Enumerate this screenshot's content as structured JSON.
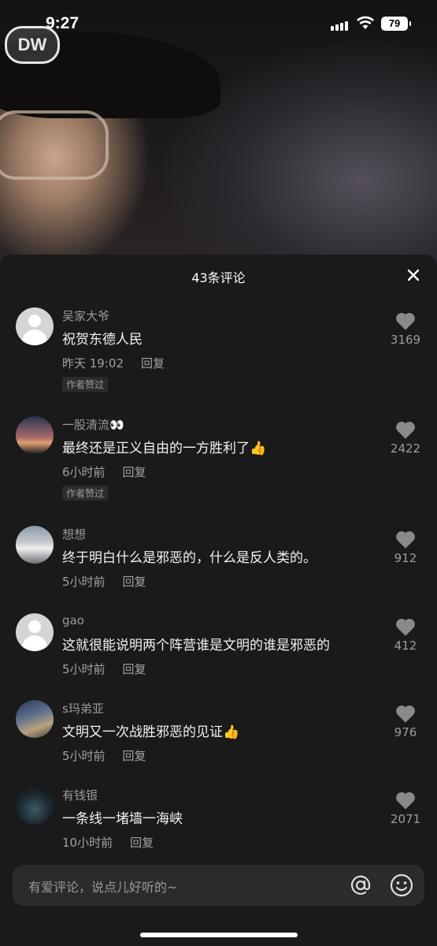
{
  "status": {
    "time": "9:27",
    "battery": "79"
  },
  "video": {
    "logo_text": "DW"
  },
  "sheet": {
    "title": "43条评论"
  },
  "comments": [
    {
      "username": "吴家大爷",
      "text": "祝贺东德人民",
      "time": "昨天 19:02",
      "reply": "回复",
      "badge": "作者赞过",
      "likes": "3169",
      "avatar": "default"
    },
    {
      "username": "一股清流👀",
      "text": "最终还是正义自由的一方胜利了👍",
      "time": "6小时前",
      "reply": "回复",
      "badge": "作者赞过",
      "likes": "2422",
      "avatar": "sunset"
    },
    {
      "username": "想想",
      "text": "终于明白什么是邪恶的，什么是反人类的。",
      "time": "5小时前",
      "reply": "回复",
      "likes": "912",
      "avatar": "car"
    },
    {
      "username": "gao",
      "text": "这就很能说明两个阵营谁是文明的谁是邪恶的",
      "time": "5小时前",
      "reply": "回复",
      "likes": "412",
      "avatar": "default"
    },
    {
      "username": "s玛弟亚",
      "text": "文明又一次战胜邪恶的见证👍",
      "time": "5小时前",
      "reply": "回复",
      "likes": "976",
      "avatar": "street"
    },
    {
      "username": "有钱银",
      "text": "一条线一堵墙一海峡",
      "time": "10小时前",
      "reply": "回复",
      "likes": "2071",
      "avatar": "tower"
    }
  ],
  "input": {
    "placeholder": "有爱评论，说点儿好听的~"
  },
  "icons": {
    "close": "close-icon",
    "like": "heart-icon",
    "at": "at-icon",
    "emoji": "smile-icon"
  }
}
